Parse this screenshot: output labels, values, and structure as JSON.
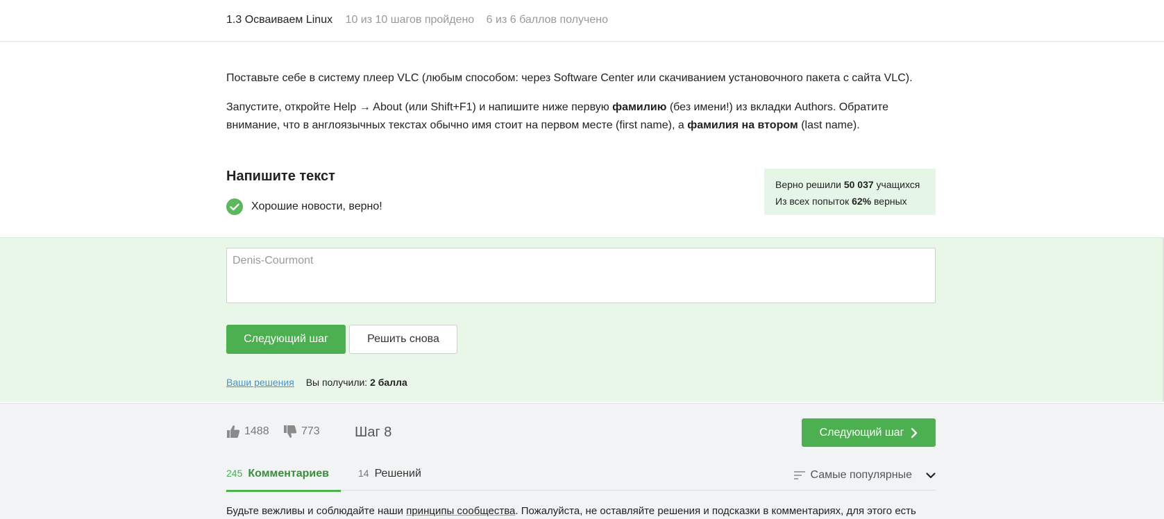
{
  "header": {
    "lesson_title": "1.3 Осваиваем Linux",
    "steps_progress": "10 из 10 шагов пройдено",
    "points_progress": "6 из 6 баллов  получено"
  },
  "step": {
    "p1": "Поставьте себе в систему плеер VLC (любым способом: через Software Center или скачиванием установочного пакета с сайта VLC).",
    "p2_a": "Запустите, откройте Help → About (или Shift+F1) и напишите ниже первую ",
    "p2_b": "фамилию",
    "p2_c": " (без имени!) из вкладки Authors. Обратите внимание, что в англоязычных текстах обычно имя стоит на первом месте (first name), а ",
    "p2_d": "фамилия на втором",
    "p2_e": " (last name)."
  },
  "quiz": {
    "title": "Напишите текст",
    "status": "Хорошие новости, верно!",
    "stats_line1_pre": "Верно решили ",
    "stats_line1_value": "50 037",
    "stats_line1_post": " учащихся",
    "stats_line2_pre": "Из всех попыток ",
    "stats_line2_value": "62%",
    "stats_line2_post": " верных",
    "answer_value": "Denis-Courmont",
    "next_button": "Следующий шаг",
    "retry_button": "Решить снова",
    "your_solutions": "Ваши решения",
    "got_label": "Вы получили: ",
    "got_value": "2 балла"
  },
  "footer": {
    "likes": "1488",
    "dislikes": "773",
    "step_label": "Шаг 8",
    "next_button": "Следующий шаг",
    "tabs": [
      {
        "count": "245",
        "label": "Комментариев"
      },
      {
        "count": "14",
        "label": "Решений"
      }
    ],
    "sort_label": "Самые популярные",
    "rules_pre": "Будьте вежливы и соблюдайте наши ",
    "rules_link": "принципы сообщества",
    "rules_post": ". Пожалуйста, не оставляйте решения и подсказки в комментариях, для этого есть"
  },
  "colors": {
    "accent_green": "#4caf50",
    "answer_bg": "#e8f7e8",
    "stats_bg": "#e6f6e6",
    "link_blue": "#4a90c8"
  },
  "icons": [
    "check-icon",
    "thumbs-up-icon",
    "thumbs-down-icon",
    "chevron-right-icon",
    "sort-icon",
    "chevron-down-icon"
  ]
}
